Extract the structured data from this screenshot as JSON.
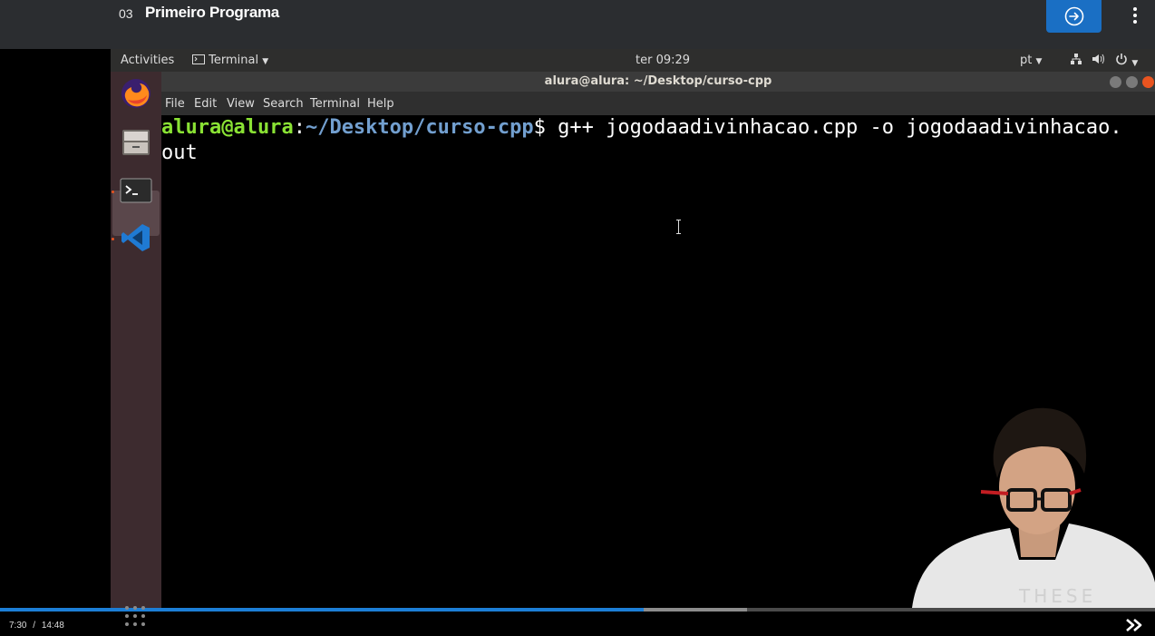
{
  "lesson": {
    "number": "03",
    "title": "Primeiro Programa"
  },
  "topbar": {
    "next_icon": "arrow-right-circle-icon",
    "menu_icon": "kebab-menu-icon"
  },
  "gnome": {
    "activities": "Activities",
    "app_menu": "Terminal",
    "clock": "ter 09:29",
    "lang": "pt"
  },
  "dock": {
    "apps": [
      "firefox-icon",
      "files-icon",
      "terminal-icon",
      "vscode-icon"
    ]
  },
  "terminal": {
    "title": "alura@alura: ~/Desktop/curso-cpp",
    "menu": [
      "File",
      "Edit",
      "View",
      "Search",
      "Terminal",
      "Help"
    ],
    "prompt_user": "alura@alura",
    "prompt_sep": ":",
    "prompt_path": "~/Desktop/curso-cpp",
    "prompt_end": "$ ",
    "command_line1": "g++ jogodaadivinhacao.cpp -o jogodaadivinhacao.",
    "command_line2": "out"
  },
  "player": {
    "current_time": "7:30",
    "separator": "/",
    "duration": "14:48",
    "progress": 0.557,
    "buffered": 0.647
  },
  "colors": {
    "accent": "#1a6fc4",
    "progress": "#1c7ed6",
    "ubuntu_orange": "#e95420"
  }
}
